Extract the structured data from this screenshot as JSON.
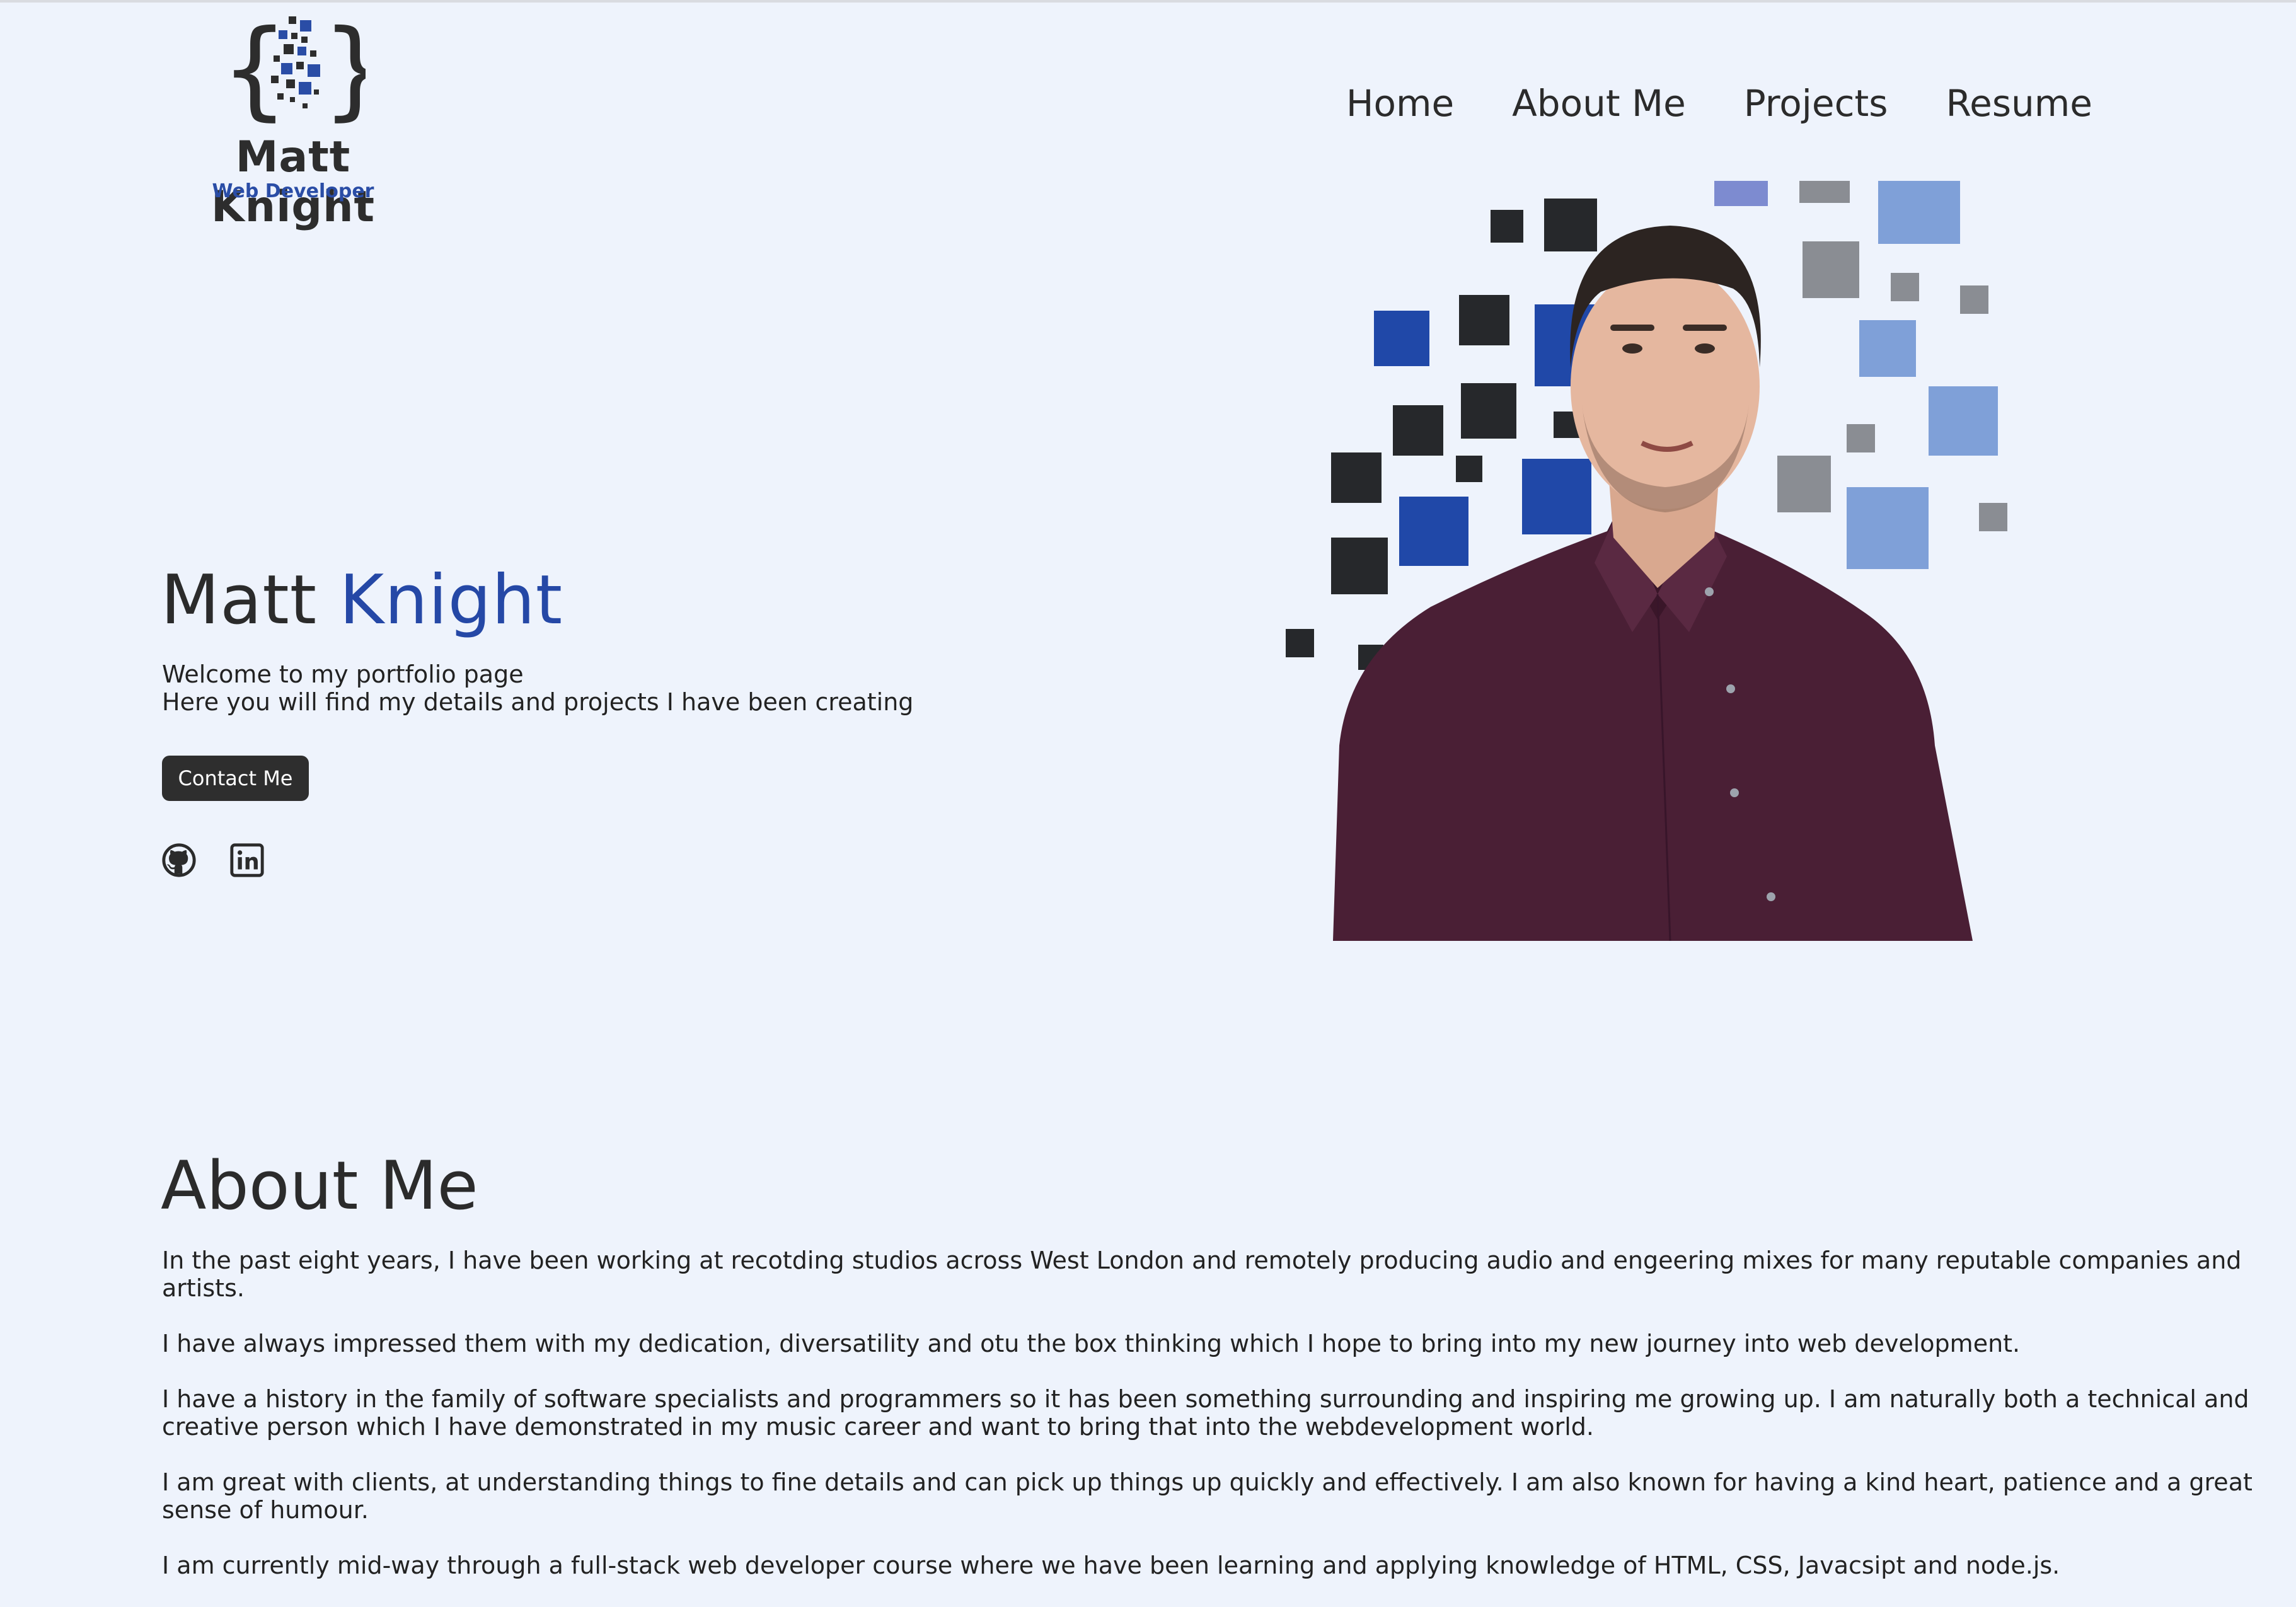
{
  "header": {
    "logo": {
      "name": "Matt Knight",
      "subtitle": "Web Developer"
    },
    "nav": [
      {
        "label": "Home"
      },
      {
        "label": "About Me"
      },
      {
        "label": "Projects"
      },
      {
        "label": "Resume"
      }
    ]
  },
  "hero": {
    "title_first": "Matt",
    "title_last": "Knight",
    "line1": "Welcome to my portfolio page",
    "line2": "Here you will find my details and projects I have been creating",
    "contact_button": "Contact Me",
    "social": [
      "github-icon",
      "linkedin-icon"
    ]
  },
  "about": {
    "title": "About Me",
    "paragraphs": [
      "In the past eight years, I have been working at recotding studios across West London and remotely producing audio and engeering mixes for many reputable companies and artists.",
      "I have always impressed them with my dedication, diversatility and otu the box thinking which I hope to bring into my new journey into web development.",
      "I have a history in the family of software specialists and programmers so it has been something surrounding and inspiring me growing up. I am naturally both a technical and creative person which I have demonstrated in my music career and want to bring that into the webdevelopment world.",
      "I am great with clients, at understanding things to fine details and can pick up things up quickly and effectively. I am also known for having a kind heart, patience and a great sense of humour.",
      "I am currently mid-way through a full-stack web developer course where we have been learning and applying knowledge of HTML, CSS, Javacsipt and node.js."
    ]
  },
  "colors": {
    "background": "#eef3fc",
    "accent": "#2548a6",
    "text": "#2b2b2b",
    "button": "#2e2e2e",
    "shirt": "#4a1f35"
  }
}
